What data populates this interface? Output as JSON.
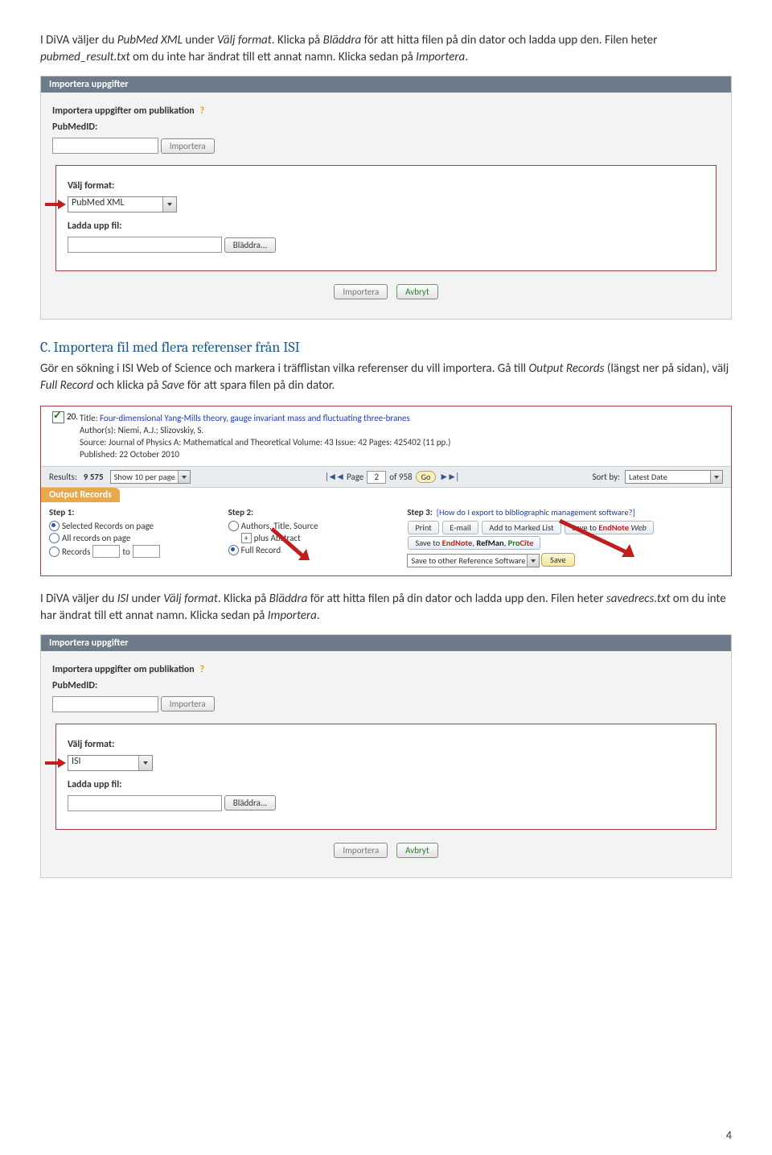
{
  "intro1": {
    "t1": "I DiVA väljer du ",
    "fmt": "PubMed XML",
    "t2": " under ",
    "sel": "Välj format",
    "t3": ". Klicka på ",
    "browse": "Bläddra",
    "t4": " för att hitta filen på din dator och ladda upp den. Filen heter ",
    "file": "pubmed_result.txt",
    "t5": " om du inte har ändrat till ett annat namn. Klicka sedan på ",
    "imp": "Importera",
    "t6": "."
  },
  "panel": {
    "header": "Importera uppgifter",
    "pub_label": "Importera uppgifter om publikation",
    "help": "?",
    "pubmedid": "PubMedID:",
    "importera": "Importera",
    "valj_format": "Välj format:",
    "ladda_upp": "Ladda upp fil:",
    "bladra": "Bläddra...",
    "avbryt": "Avbryt",
    "fmt1": "PubMed XML",
    "fmt2": "ISI"
  },
  "sectionC": {
    "title": "C. Importera fil med flera referenser från ISI",
    "p": "Gör en sökning i ISI Web of Science och markera i träfflistan vilka referenser du vill importera. Gå till ",
    "out": "Output Records",
    "p2": " (längst ner på sidan), välj ",
    "full": "Full Record",
    "p3": " och klicka på ",
    "save": "Save",
    "p4": " för att spara filen på din dator."
  },
  "isi": {
    "num": "20.",
    "title_lbl": "Title:",
    "title_link": "Four-dimensional Yang-Mills theory, gauge invariant mass and fluctuating three-branes",
    "auth_lbl": "Author(s):",
    "authors": "Niemi, A.J.; Slizovskiy, S.",
    "src_lbl": "Source:",
    "source": "Journal of Physics A: Mathematical and Theoretical Volume: 43 Issue: 42 Pages: 425402 (11 pp.)",
    "pub_lbl": "Published:",
    "published": "22 October 2010",
    "results_lbl": "Results:",
    "results_count": "9 575",
    "show_per": "Show 10 per page",
    "page_lbl": "Page",
    "page_val": "2",
    "of": "of 958",
    "go": "Go",
    "sort_lbl": "Sort by:",
    "sort_val": "Latest Date",
    "output": "Output Records",
    "step1": "Step 1:",
    "step2": "Step 2:",
    "step3": "Step 3:",
    "step3_link": "[How do I export to bibliographic management software?]",
    "r1": "Selected Records on page",
    "r2": "All records on page",
    "r3": "Records",
    "to": "to",
    "s2a": "Authors, Title, Source",
    "s2b": "plus Abstract",
    "s2c": "Full Record",
    "pill_print": "Print",
    "pill_email": "E-mail",
    "pill_add": "Add to Marked List",
    "pill_enweb_pre": "Save to ",
    "pill_en": "EndNote",
    "pill_web": " Web",
    "pill_refman": "RefMan",
    "pill_procite_pre": "Pro",
    "pill_procite_c": "Cite",
    "other": "Save to other Reference Software",
    "save_btn": "Save"
  },
  "intro2": {
    "t1": "I DiVA väljer du ",
    "fmt": "ISI",
    "t2": " under ",
    "sel": "Välj format",
    "t3": ". Klicka på ",
    "browse": "Bläddra",
    "t4": " för att hitta filen på din dator och ladda upp den. Filen heter ",
    "file": "savedrecs.txt",
    "t5": " om du inte har ändrat till ett annat namn. Klicka sedan på ",
    "imp": "Importera",
    "t6": "."
  },
  "page_number": "4"
}
